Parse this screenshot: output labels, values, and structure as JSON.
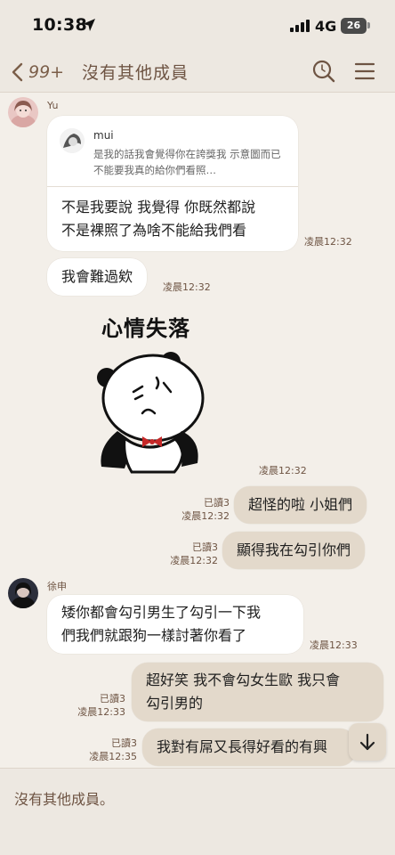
{
  "status_bar": {
    "time": "10:38",
    "network": "4G",
    "battery": "26"
  },
  "header": {
    "back_count": "99+",
    "title": "沒有其他成員",
    "icons": [
      "chevron-left-icon",
      "search-icon",
      "menu-icon"
    ]
  },
  "messages": {
    "m1": {
      "sender": "Yu",
      "reply_to": {
        "name": "mui",
        "text": "是我的話我會覺得你在誇獎我 示意圖而已 不能要我真的給你們看照…"
      },
      "text_line1": "不是我要說 我覺得 你既然都說",
      "text_line2": "不是裸照了為啥不能給我們看",
      "time": "凌晨12:32"
    },
    "m2": {
      "text": "我會難過欸",
      "time": "凌晨12:32"
    },
    "m3": {
      "sticker_text": "心情失落",
      "time": "凌晨12:32"
    },
    "m4": {
      "read": "已讀3",
      "time": "凌晨12:32",
      "text": "超怪的啦 小姐們"
    },
    "m5": {
      "read": "已讀3",
      "time": "凌晨12:32",
      "text": "顯得我在勾引你們"
    },
    "m6": {
      "sender": "徐申",
      "text_line1": "矮你都會勾引男生了勾引一下我",
      "text_line2": "們我們就跟狗一樣討著你看了",
      "time": "凌晨12:33"
    },
    "m7": {
      "read": "已讀3",
      "time": "凌晨12:33",
      "text_line1": "超好笑 我不會勾女生歐 我只會",
      "text_line2": "勾引男的"
    },
    "m8": {
      "read": "已讀3",
      "time": "凌晨12:35",
      "text": "我對有屌又長得好看的有興"
    }
  },
  "footer": {
    "text": "沒有其他成員。"
  },
  "colors": {
    "background": "#f3efe9",
    "bar": "#ede8e1",
    "accent": "#6e5443",
    "my_bubble": "#e3d9cb",
    "their_bubble": "#ffffff"
  }
}
